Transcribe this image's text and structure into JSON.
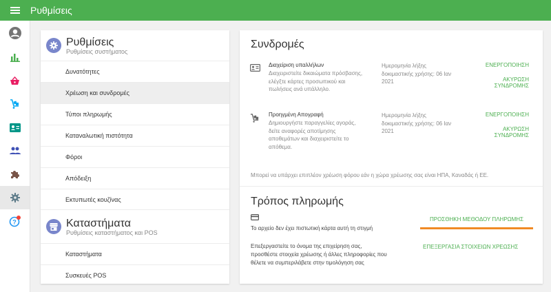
{
  "topbar": {
    "title": "Ρυθμίσεις"
  },
  "rail": {
    "items": [
      {
        "name": "account-icon",
        "color": "#757575"
      },
      {
        "name": "bar-chart-icon",
        "color": "#4caf50"
      },
      {
        "name": "basket-icon",
        "color": "#e91e63"
      },
      {
        "name": "inventory-icon",
        "color": "#03a9f4"
      },
      {
        "name": "badge-icon",
        "color": "#009688"
      },
      {
        "name": "people-icon",
        "color": "#3f51b5"
      },
      {
        "name": "puzzle-icon",
        "color": "#795548"
      },
      {
        "name": "gear-icon",
        "color": "#607d8b",
        "active": true
      },
      {
        "name": "help-icon",
        "color": "#2196f3",
        "badge_color": "#f44336"
      }
    ]
  },
  "settings": {
    "title": "Ρυθμίσεις",
    "subtitle": "Ρυθμίσεις συστήματος",
    "items": [
      "Δυνατότητες",
      "Χρέωση και συνδρομές",
      "Τύποι πληρωμής",
      "Καταναλωτική πιστότητα",
      "Φόροι",
      "Απόδειξη",
      "Εκτυπωτές κουζίνας"
    ],
    "active_index": 1
  },
  "stores": {
    "title": "Καταστήματα",
    "subtitle": "Ρυθμίσεις καταστήματος και POS",
    "items": [
      "Καταστήματα",
      "Συσκευές POS"
    ]
  },
  "subscriptions": {
    "title": "Συνδρομές",
    "rows": [
      {
        "name": "Διαχείριση υπαλλήλων",
        "description": "Διαχειριστείτε δικαιώματα πρόσβασης, ελέγξτε κάρτες προσωπικού και πωλήσεις ανά υπάλληλο.",
        "trial": "Ημερομηνία λήξης δοκιμαστικής χρήσης: 06 Ιαν 2021",
        "activate": "ΕΝΕΡΓΟΠΟΙΗΣΗ",
        "cancel": "ΑΚΥΡΩΣΗ ΣΥΝΔΡΟΜΗΣ"
      },
      {
        "name": "Προηγμένη Απογραφή",
        "description": "Δημιουργήστε παραγγελίες αγοράς, δείτε αναφορές αποτίμησης αποθεμάτων και διαχειριστείτε το απόθεμα.",
        "trial": "Ημερομηνία λήξης δοκιμαστικής χρήσης: 06 Ιαν 2021",
        "activate": "ΕΝΕΡΓΟΠΟΙΗΣΗ",
        "cancel": "ΑΚΥΡΩΣΗ ΣΥΝΔΡΟΜΗΣ"
      }
    ],
    "tax_note": "Μπορεί να υπάρχει επιπλέον χρέωση φόρου εάν η χώρα χρέωσης σας είναι ΗΠΑ, Καναδάς ή ΕΕ."
  },
  "payment": {
    "title": "Τρόπος πληρωμής",
    "no_card": "Το αρχείο δεν έχει πιστωτική κάρτα αυτή τη στιγμή",
    "add_method": "ΠΡΟΣΘΗΚΗ ΜΕΘΟΔΟΥ ΠΛΗΡΩΜΗΣ",
    "billing_description": "Επεξεργαστείτε το όνομα της επιχείρηση σας, προσθέστε στοιχεία χρέωσης ή άλλες πληροφορίες που θέλετε να συμπεριλάβετε στην τιμολόγηση σας",
    "edit_billing": "ΕΠΕΞΕΡΓΑΣΙΑ ΣΤΟΙΧΕΙΩΝ ΧΡΕΩΣΗΣ",
    "underline_color": "#f08a24"
  },
  "colors": {
    "accent": "#4caf50",
    "section_icon": "#7986cb"
  }
}
